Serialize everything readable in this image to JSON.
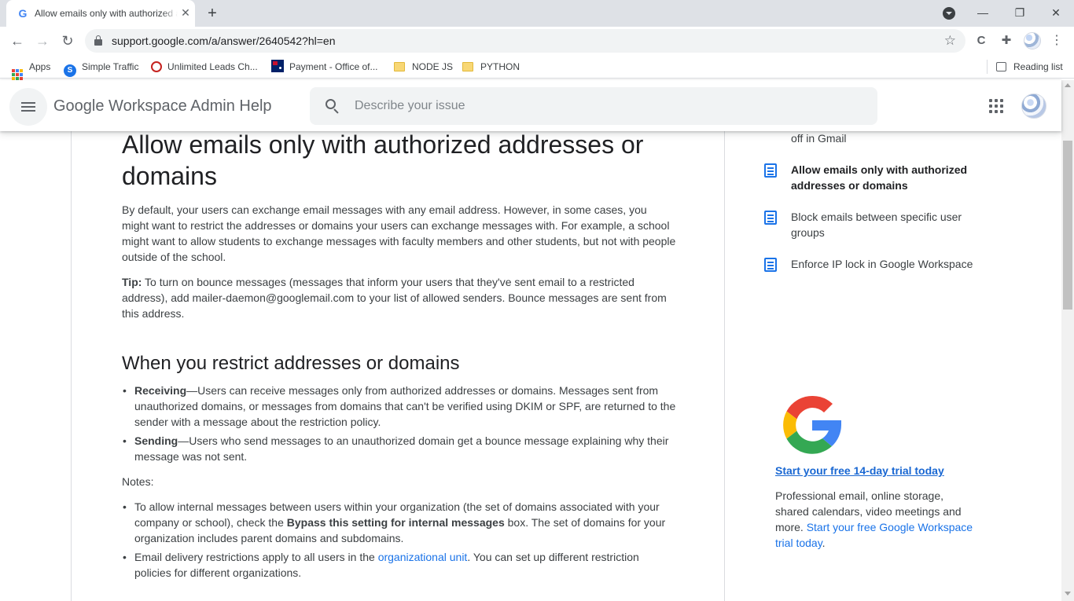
{
  "browser": {
    "tab_title": "Allow emails only with authorized addresses or domains",
    "tab_favicon": "G",
    "url": "support.google.com/a/answer/2640542?hl=en",
    "bookmarks": [
      {
        "label": "Apps",
        "icon": "apps-grid-icon"
      },
      {
        "label": "Simple Traffic",
        "icon": "simple-traffic-icon"
      },
      {
        "label": "Unlimited Leads Ch...",
        "icon": "unlimited-leads-icon"
      },
      {
        "label": "Payment - Office of...",
        "icon": "australia-flag-icon"
      },
      {
        "label": "NODE JS",
        "icon": "folder-icon"
      },
      {
        "label": "PYTHON",
        "icon": "folder-icon"
      }
    ],
    "reading_list": "Reading list"
  },
  "appbar": {
    "product_name": "Google Workspace Admin Help",
    "search_placeholder": "Describe your issue"
  },
  "article": {
    "title": "Allow emails only with authorized addresses or domains",
    "intro": "By default, your users can exchange email messages with any email address. However, in some cases, you might want to restrict the addresses or domains your users can exchange messages with. For example, a school might want to allow students to exchange messages with faculty members and other students, but not with people outside of the school.",
    "tip_label": "Tip:",
    "tip_text": " To turn on bounce messages (messages that inform your users that they've sent email to a restricted address), add mailer-daemon@googlemail.com to your list of allowed senders. Bounce messages are sent from this address.",
    "section_heading": "When you restrict addresses or domains",
    "receiving_label": "Receiving",
    "receiving_text": "—Users can receive messages only from authorized addresses or domains. Messages sent from unauthorized domains, or messages from domains that can't be verified using DKIM or SPF, are returned to the sender with a message about the restriction policy.",
    "sending_label": "Sending",
    "sending_text": "—Users who send messages to an unauthorized domain get a bounce message explaining why their message was not sent.",
    "notes_label": "Notes",
    "notes_colon": ":",
    "note1_before": "To allow internal messages between users within your organization (the set of domains associated with your company or school), check the ",
    "note1_bold": "Bypass this setting for internal messages",
    "note1_after": " box. The set of domains for your organization includes parent domains and subdomains.",
    "note2_before": "Email delivery restrictions apply to all users in the ",
    "note2_link": "organizational unit",
    "note2_after": ". You can set up different restriction policies for different organizations."
  },
  "related": {
    "partial_item": "off in Gmail",
    "items": [
      {
        "label": "Allow emails only with authorized addresses or domains",
        "current": true
      },
      {
        "label": "Block emails between specific user groups",
        "current": false
      },
      {
        "label": "Enforce IP lock in Google Workspace",
        "current": false
      }
    ]
  },
  "promo": {
    "cta": "Start your free 14-day trial today",
    "text": "Professional email, online storage, shared calendars, video meetings and more. ",
    "link": "Start your free Google Workspace trial today",
    "link_after": "."
  },
  "colors": {
    "link": "#1a73e8",
    "google_blue": "#4285f4",
    "google_red": "#ea4335",
    "google_yellow": "#fbbc05",
    "google_green": "#34a853"
  }
}
